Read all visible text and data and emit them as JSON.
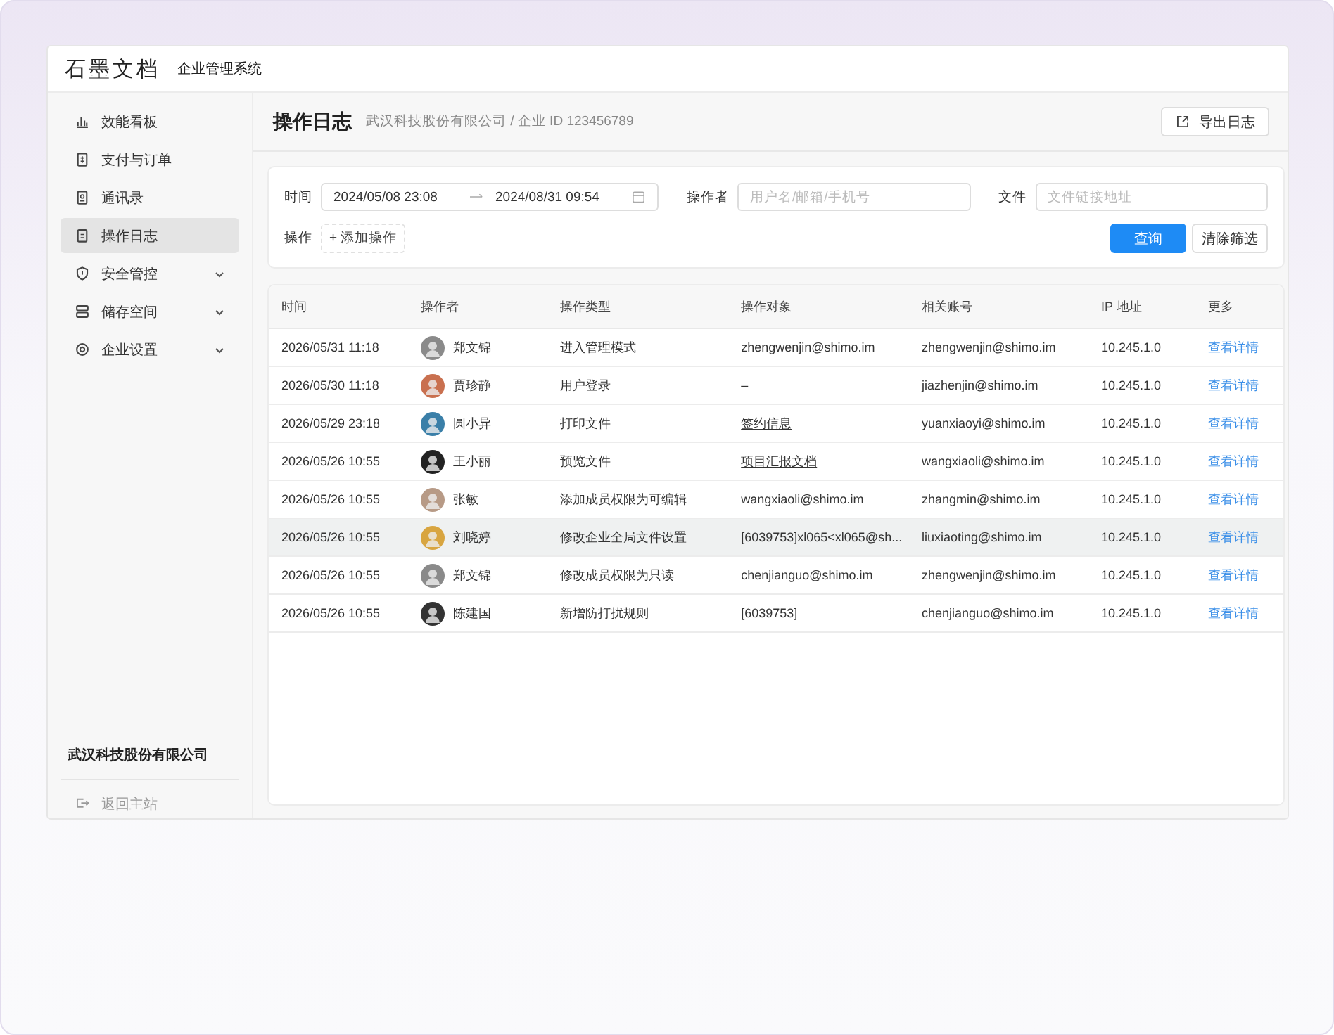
{
  "header": {
    "logo": "石墨文档",
    "subtitle": "企业管理系统"
  },
  "sidebar": {
    "items": [
      {
        "label": "效能看板",
        "kind": "link",
        "selected": false
      },
      {
        "label": "支付与订单",
        "kind": "link",
        "selected": false
      },
      {
        "label": "通讯录",
        "kind": "link",
        "selected": false
      },
      {
        "label": "操作日志",
        "kind": "link",
        "selected": true
      },
      {
        "label": "安全管控",
        "kind": "group",
        "expanded": false,
        "selected": false
      },
      {
        "label": "储存空间",
        "kind": "group",
        "expanded": false,
        "selected": false
      },
      {
        "label": "企业设置",
        "kind": "group",
        "expanded": false,
        "selected": false
      }
    ],
    "company": "武汉科技股份有限公司",
    "back": "返回主站"
  },
  "page": {
    "title": "操作日志",
    "breadcrumb": "武汉科技股份有限公司 / 企业 ID 123456789",
    "export_button": "导出日志"
  },
  "filters": {
    "time_label": "时间",
    "start": "2024/05/08 23:08",
    "end": "2024/08/31 09:54",
    "operator_label": "操作者",
    "operator_placeholder": "用户名/邮箱/手机号",
    "file_label": "文件",
    "file_placeholder": "文件链接地址",
    "action_label": "操作",
    "add_action": "+ 添加操作",
    "query_button": "查询",
    "clear_button": "清除筛选"
  },
  "table": {
    "columns": [
      "时间",
      "操作者",
      "操作类型",
      "操作对象",
      "相关账号",
      "IP 地址",
      "更多"
    ],
    "rows": [
      {
        "time": "2026/05/31 11:18",
        "operator": "郑文锦",
        "action": "进入管理模式",
        "target": "zhengwenjin@shimo.im",
        "target_underlined": false,
        "account": "zhengwenjin@shimo.im",
        "ip": "10.245.1.0",
        "more": "查看详情",
        "highlighted": false
      },
      {
        "time": "2026/05/30 11:18",
        "operator": "贾珍静",
        "action": "用户登录",
        "target": "–",
        "target_underlined": false,
        "account": "jiazhenjin@shimo.im",
        "ip": "10.245.1.0",
        "more": "查看详情",
        "highlighted": false
      },
      {
        "time": "2026/05/29 23:18",
        "operator": "圆小异",
        "action": "打印文件",
        "target": "签约信息",
        "target_underlined": true,
        "account": "yuanxiaoyi@shimo.im",
        "ip": "10.245.1.0",
        "more": "查看详情",
        "highlighted": false
      },
      {
        "time": "2026/05/26 10:55",
        "operator": "王小丽",
        "action": "预览文件",
        "target": "项目汇报文档",
        "target_underlined": true,
        "account": "wangxiaoli@shimo.im",
        "ip": "10.245.1.0",
        "more": "查看详情",
        "highlighted": false
      },
      {
        "time": "2026/05/26 10:55",
        "operator": "张敏",
        "action": "添加成员权限为可编辑",
        "target": "wangxiaoli@shimo.im",
        "target_underlined": false,
        "account": "zhangmin@shimo.im",
        "ip": "10.245.1.0",
        "more": "查看详情",
        "highlighted": false
      },
      {
        "time": "2026/05/26 10:55",
        "operator": "刘晓婷",
        "action": "修改企业全局文件设置",
        "target": "[6039753]xl065<xl065@sh...",
        "target_underlined": false,
        "account": "liuxiaoting@shimo.im",
        "ip": "10.245.1.0",
        "more": "查看详情",
        "highlighted": true
      },
      {
        "time": "2026/05/26 10:55",
        "operator": "郑文锦",
        "action": "修改成员权限为只读",
        "target": "chenjianguo@shimo.im",
        "target_underlined": false,
        "account": "zhengwenjin@shimo.im",
        "ip": "10.245.1.0",
        "more": "查看详情",
        "highlighted": false
      },
      {
        "time": "2026/05/26 10:55",
        "operator": "陈建国",
        "action": "新增防打扰规则",
        "target": "[6039753]",
        "target_underlined": false,
        "account": "chenjianguo@shimo.im",
        "ip": "10.245.1.0",
        "more": "查看详情",
        "highlighted": false
      }
    ]
  }
}
